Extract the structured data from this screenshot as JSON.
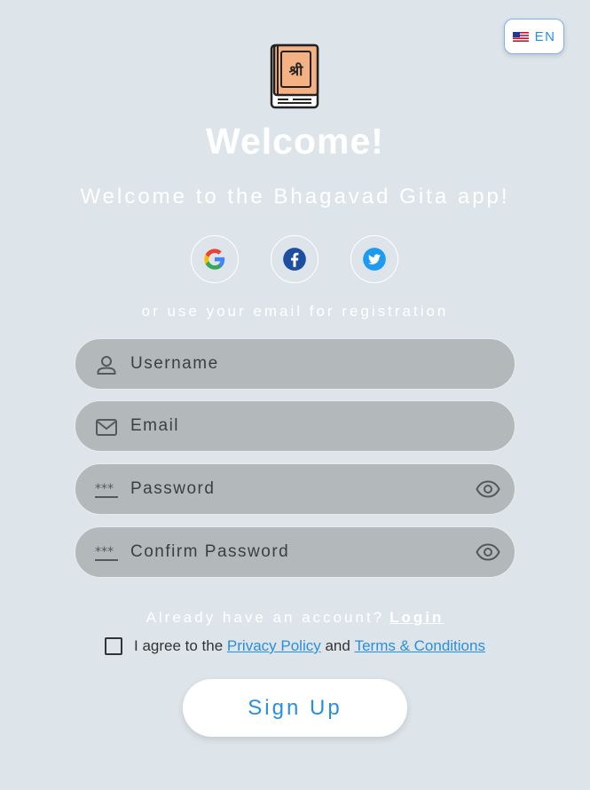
{
  "language": {
    "code": "EN",
    "flag_icon": "us-flag-icon"
  },
  "header": {
    "logo_icon": "bhagavad-gita-book-icon",
    "logo_glyph": "श्री",
    "title": "Welcome!",
    "subtitle": "Welcome to the Bhagavad Gita app!"
  },
  "social": {
    "buttons": [
      {
        "icon": "google-icon"
      },
      {
        "icon": "facebook-icon"
      },
      {
        "icon": "twitter-icon"
      }
    ],
    "or_text": "or use your email for registration"
  },
  "form": {
    "username": {
      "placeholder": "Username",
      "value": "",
      "icon": "user-icon"
    },
    "email": {
      "placeholder": "Email",
      "value": "",
      "icon": "mail-icon"
    },
    "password": {
      "placeholder": "Password",
      "value": "",
      "icon": "password-icon"
    },
    "confirm_password": {
      "placeholder": "Confirm Password",
      "value": "",
      "icon": "password-icon"
    }
  },
  "login_prompt": {
    "text": "Already have an account?",
    "link": "Login"
  },
  "agreement": {
    "prefix": "I agree to the",
    "privacy": "Privacy Policy",
    "and": "and",
    "terms": "Terms & Conditions"
  },
  "signup_label": "Sign Up",
  "colors": {
    "background": "#dde5ea",
    "accent": "#2a8ee0",
    "field": "#b3b8bb"
  }
}
